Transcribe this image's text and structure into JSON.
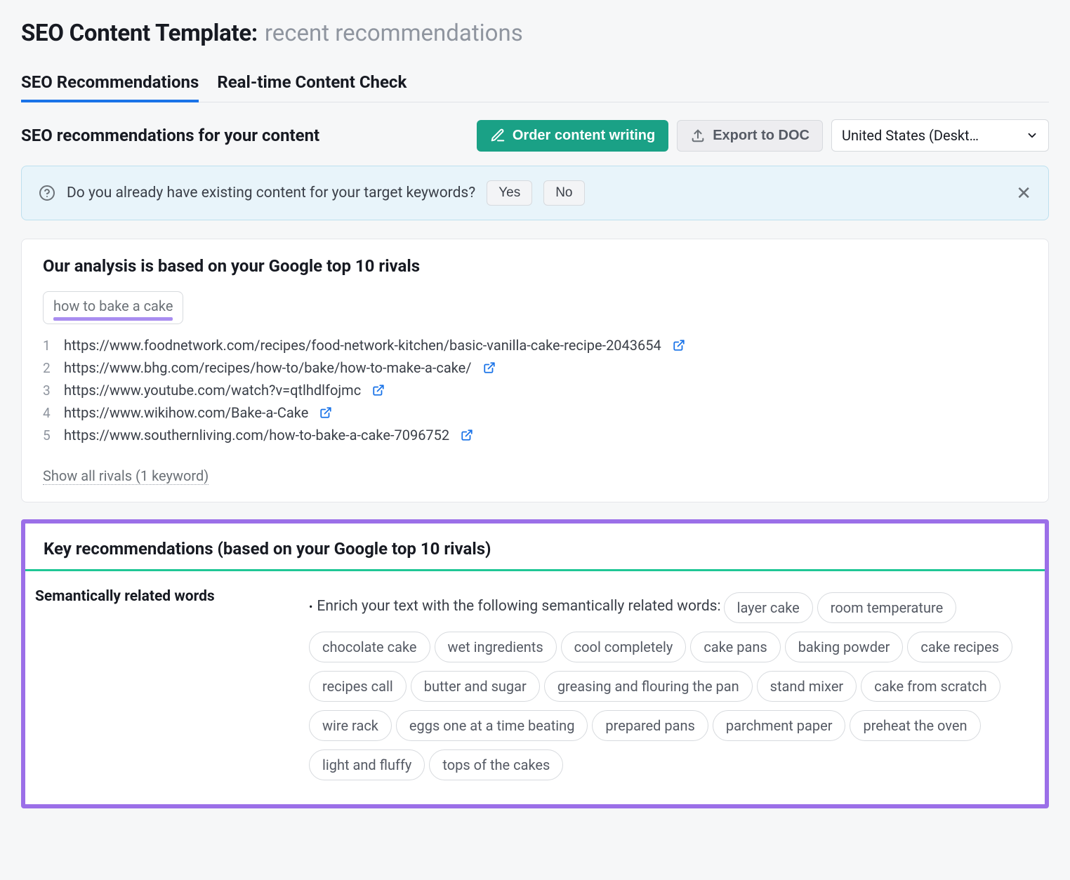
{
  "title": {
    "main": "SEO Content Template:",
    "sub": "recent recommendations"
  },
  "tabs": [
    {
      "label": "SEO Recommendations",
      "active": true
    },
    {
      "label": "Real-time Content Check",
      "active": false
    }
  ],
  "action": {
    "heading": "SEO recommendations for your content",
    "order_button": "Order content writing",
    "export_button": "Export to DOC",
    "region_select": "United States (Deskt…"
  },
  "alert": {
    "question": "Do you already have existing content for your target keywords?",
    "yes": "Yes",
    "no": "No"
  },
  "rivals_card": {
    "heading": "Our analysis is based on your Google top 10 rivals",
    "keyword": "how to bake a cake",
    "items": [
      "https://www.foodnetwork.com/recipes/food-network-kitchen/basic-vanilla-cake-recipe-2043654",
      "https://www.bhg.com/recipes/how-to/bake/how-to-make-a-cake/",
      "https://www.youtube.com/watch?v=qtlhdlfojmc",
      "https://www.wikihow.com/Bake-a-Cake",
      "https://www.southernliving.com/how-to-bake-a-cake-7096752"
    ],
    "show_all": "Show all rivals (1 keyword)"
  },
  "key_rec": {
    "heading": "Key recommendations (based on your Google top 10 rivals)",
    "section_label": "Semantically related words",
    "lead": "Enrich your text with the following semantically related words:",
    "tags": [
      "layer cake",
      "room temperature",
      "chocolate cake",
      "wet ingredients",
      "cool completely",
      "cake pans",
      "baking powder",
      "cake recipes",
      "recipes call",
      "butter and sugar",
      "greasing and flouring the pan",
      "stand mixer",
      "cake from scratch",
      "wire rack",
      "eggs one at a time beating",
      "prepared pans",
      "parchment paper",
      "preheat the oven",
      "light and fluffy",
      "tops of the cakes"
    ]
  }
}
